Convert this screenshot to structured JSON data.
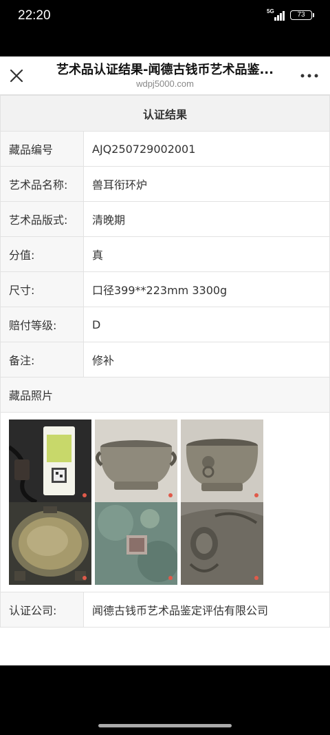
{
  "status_bar": {
    "time": "22:20",
    "network": "5G",
    "battery": "73"
  },
  "nav": {
    "title": "艺术品认证结果-闻德古钱币艺术品鉴...",
    "url": "wdpj5000.com"
  },
  "cert": {
    "header": "认证结果",
    "rows": [
      {
        "label": "藏品编号",
        "value": "AJQ250729002001"
      },
      {
        "label": "艺术品名称:",
        "value": "兽耳衔环炉"
      },
      {
        "label": "艺术品版式:",
        "value": "清晚期"
      },
      {
        "label": "分值:",
        "value": "真"
      },
      {
        "label": "尺寸:",
        "value": "口径399**223mm 3300g"
      },
      {
        "label": "赔付等级:",
        "value": "D"
      },
      {
        "label": "备注:",
        "value": "修补"
      }
    ],
    "photos_label": "藏品照片",
    "company_label": "认证公司:",
    "company_value": "闻德古钱币艺术品鉴定评估有限公司"
  },
  "photos": [
    {
      "name": "photo-certificate-tag"
    },
    {
      "name": "photo-censer-front"
    },
    {
      "name": "photo-censer-side"
    },
    {
      "name": "photo-censer-top"
    },
    {
      "name": "photo-censer-base-mark"
    },
    {
      "name": "photo-censer-handle-detail"
    }
  ],
  "icons": {
    "close": "close-icon",
    "more": "more-icon"
  }
}
